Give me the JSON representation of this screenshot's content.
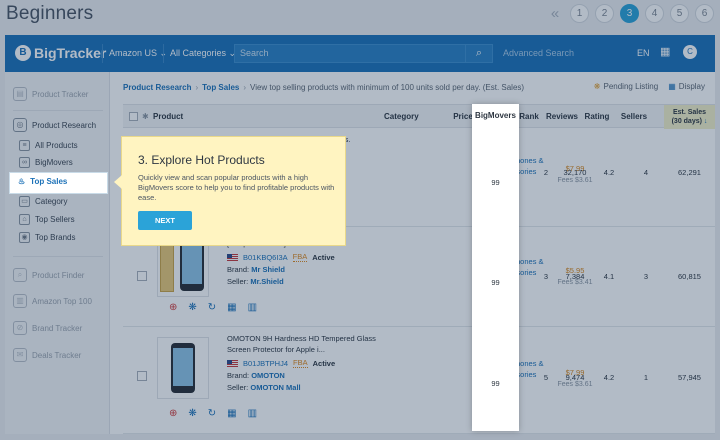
{
  "page": {
    "title": "Beginners"
  },
  "pager": {
    "pages": [
      "1",
      "2",
      "3",
      "4",
      "5",
      "6"
    ],
    "active": "3"
  },
  "topbar": {
    "logo": "BigTracker",
    "marketplace": "Amazon US",
    "category": "All Categories",
    "search_placeholder": "Search",
    "advanced": "Advanced Search",
    "language": "EN",
    "avatar": "C"
  },
  "sidebar": {
    "items": [
      {
        "label": "Product Tracker",
        "icon": "tracker-icon"
      },
      {
        "label": "Product Research",
        "icon": "research-icon"
      },
      {
        "label": "All Products",
        "icon": "list-icon"
      },
      {
        "label": "BigMovers",
        "icon": "bigmovers-icon"
      },
      {
        "label": "Top Sales",
        "icon": "flame-icon"
      },
      {
        "label": "Category",
        "icon": "category-icon"
      },
      {
        "label": "Top Sellers",
        "icon": "sellers-icon"
      },
      {
        "label": "Top Brands",
        "icon": "brands-icon"
      },
      {
        "label": "Product Finder",
        "icon": "finder-icon"
      },
      {
        "label": "Amazon Top 100",
        "icon": "top100-icon"
      },
      {
        "label": "Brand Tracker",
        "icon": "brand-tracker-icon"
      },
      {
        "label": "Deals Tracker",
        "icon": "deals-icon"
      }
    ]
  },
  "breadcrumb": {
    "section": "Product Research",
    "page": "Top Sales",
    "description": "View top selling products with minimum of 100 units sold per day. (Est. Sales)",
    "pending": "Pending Listing",
    "display": "Display"
  },
  "table": {
    "columns": {
      "product": "Product",
      "category": "Category",
      "price": "Price",
      "bigmovers": "BigMovers",
      "rank": "Rank",
      "reviews": "Reviews",
      "rating": "Rating",
      "sellers": "Sellers",
      "sales_line1": "Est. Sales",
      "sales_line2": "(30 days)"
    },
    "rows": [
      {
        "title_tail": "lass.",
        "category": "Cell Phones & Accessories",
        "price": "$7.99",
        "fees": "Fees $3.61",
        "bigmovers": "99",
        "rank": "2",
        "reviews": "32,170",
        "rating": "4.2",
        "sellers": "4",
        "sales": "62,291"
      },
      {
        "title": "[Tempered Glass] Scre...",
        "asin": "B01KBQ6I3A",
        "fba": "FBA",
        "status": "Active",
        "brand_label": "Brand:",
        "brand": "Mr Shield",
        "seller_label": "Seller:",
        "seller": "Mr.Shield",
        "category": "Cell Phones & Accessories",
        "price": "$5.95",
        "fees": "Fees $3.41",
        "bigmovers": "99",
        "rank": "3",
        "reviews": "7,384",
        "rating": "4.1",
        "sellers": "3",
        "sales": "60,815"
      },
      {
        "title": "OMOTON 9H Hardness HD Tempered Glass Screen Protector for Apple i...",
        "asin": "B01JBTPHJ4",
        "fba": "FBA",
        "status": "Active",
        "brand_label": "Brand:",
        "brand": "OMOTON",
        "seller_label": "Seller:",
        "seller": "OMOTON Mall",
        "category": "Cell Phones & Accessories",
        "price": "$7.99",
        "fees": "Fees $3.61",
        "bigmovers": "99",
        "rank": "5",
        "reviews": "9,474",
        "rating": "4.2",
        "sellers": "1",
        "sales": "57,945"
      }
    ]
  },
  "tooltip": {
    "title": "3. Explore Hot Products",
    "body": "Quickly view and scan popular products with a high BigMovers score to help you to find profitable products with ease.",
    "next": "NEXT"
  },
  "colors": {
    "brand_blue": "#1d72b8",
    "accent": "#2ba3d8",
    "tooltip_bg": "#fff4c1"
  }
}
